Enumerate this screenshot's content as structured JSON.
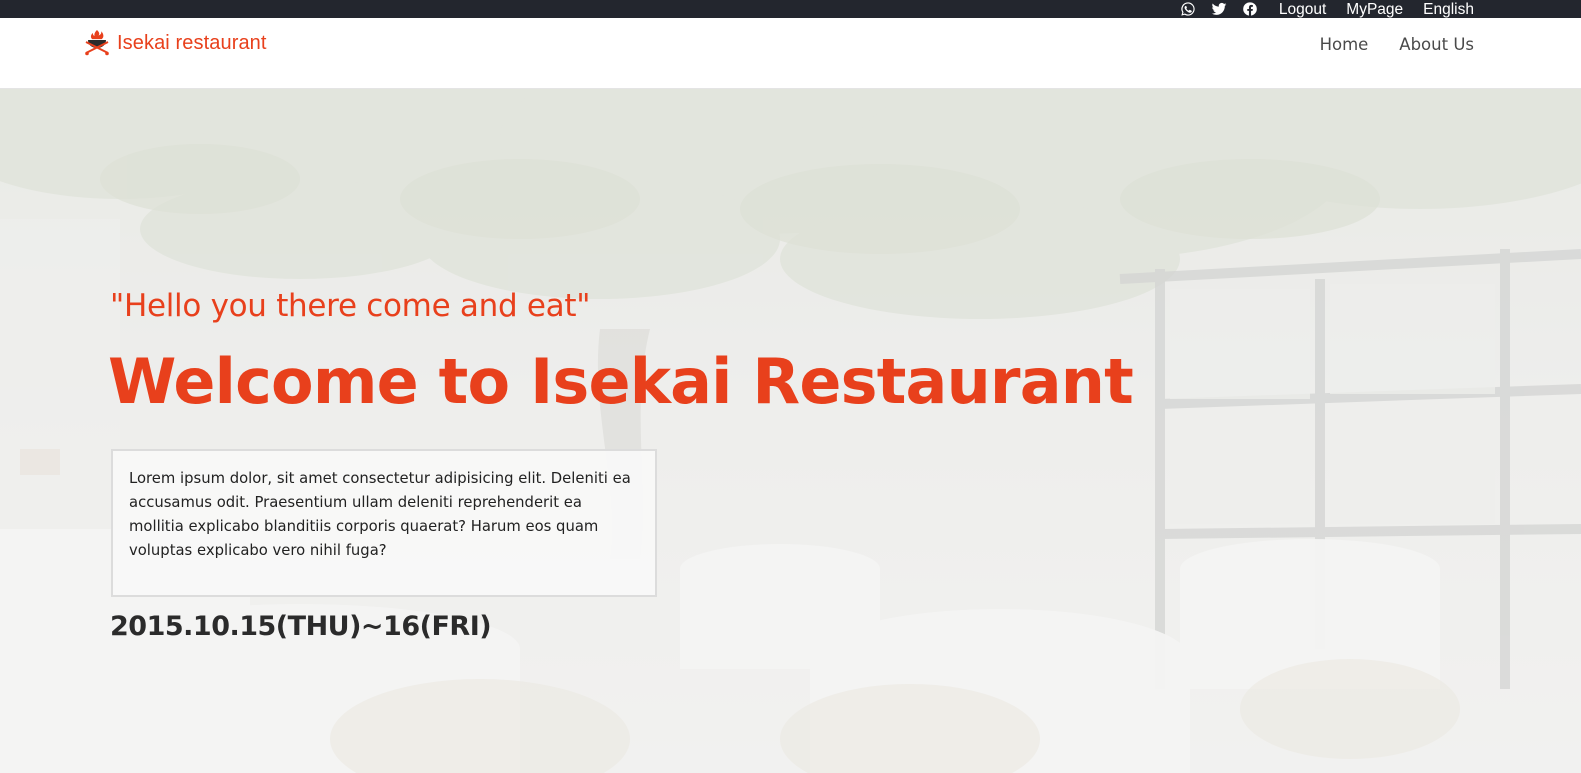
{
  "topbar": {
    "icons": [
      "whatsapp-icon",
      "twitter-icon",
      "facebook-icon"
    ],
    "links": [
      "Logout",
      "MyPage",
      "English"
    ]
  },
  "brand": {
    "name": "Isekai restaurant"
  },
  "nav": {
    "items": [
      "Home",
      "About Us"
    ]
  },
  "hero": {
    "tagline": "\"Hello you there come and eat\"",
    "headline": "Welcome to Isekai Restaurant",
    "description": "Lorem ipsum dolor, sit amet consectetur adipisicing elit. Deleniti ea accusamus odit. Praesentium ullam deleniti reprehenderit ea mollitia explicabo blanditiis corporis quaerat? Harum eos quam voluptas explicabo vero nihil fuga?",
    "date": "2015.10.15(THU)~16(FRI)"
  },
  "colors": {
    "accent": "#e8401c",
    "topbar": "#23262e",
    "text": "#222222"
  }
}
